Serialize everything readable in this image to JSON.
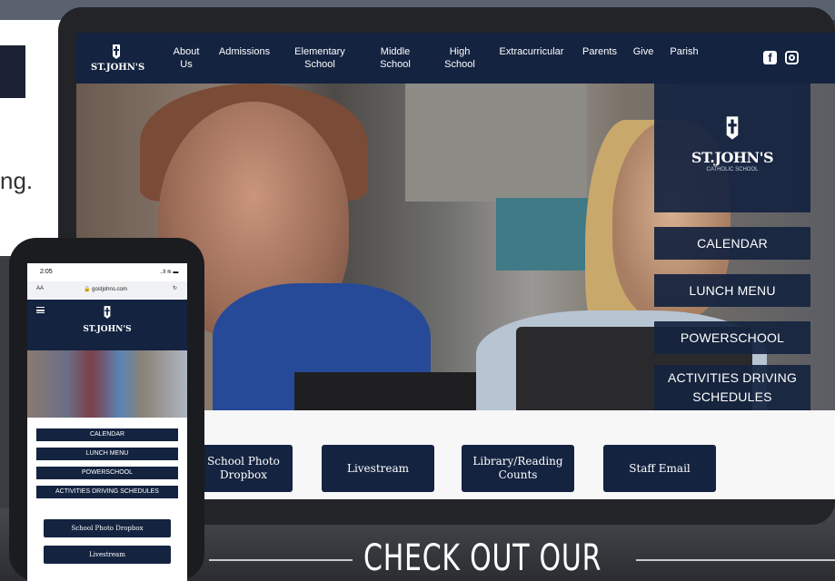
{
  "colors": {
    "navy": "#142340",
    "white": "#ffffff",
    "device_dark": "#222428",
    "background": "#3a3d42"
  },
  "background": {
    "side_text": "ng.",
    "tagline": "CHECK OUT OUR"
  },
  "tablet": {
    "nav": {
      "logo_text": "ST.JOHN'S",
      "items": [
        {
          "label": "About Us"
        },
        {
          "label": "Admissions"
        },
        {
          "label": "Elementary School"
        },
        {
          "label": "Middle School"
        },
        {
          "label": "High School"
        },
        {
          "label": "Extracurricular"
        },
        {
          "label": "Parents"
        },
        {
          "label": "Give"
        },
        {
          "label": "Parish"
        }
      ],
      "social_icons": [
        "facebook-icon",
        "instagram-icon"
      ]
    },
    "side_panel": {
      "logo_text": "ST.JOHN'S",
      "logo_subtext": "CATHOLIC SCHOOL",
      "buttons": [
        {
          "label": "CALENDAR"
        },
        {
          "label": "LUNCH MENU"
        },
        {
          "label": "POWERSCHOOL"
        },
        {
          "label": "ACTIVITIES DRIVING SCHEDULES"
        }
      ]
    },
    "quick_links": [
      {
        "label": "School Photo Dropbox"
      },
      {
        "label": "Livestream"
      },
      {
        "label": "Library/Reading Counts"
      },
      {
        "label": "Staff Email"
      }
    ]
  },
  "phone": {
    "status": {
      "time": "2:05",
      "signal": "..ll ≋ ▬"
    },
    "url_bar": {
      "aa": "AA",
      "host": "🔒 gostjohns.com",
      "reload": "↻"
    },
    "logo_text": "ST.JOHN'S",
    "buttons": [
      {
        "label": "CALENDAR"
      },
      {
        "label": "LUNCH MENU"
      },
      {
        "label": "POWERSCHOOL"
      },
      {
        "label": "ACTIVITIES DRIVING SCHEDULES"
      }
    ],
    "quick_links": [
      {
        "label": "School Photo Dropbox"
      },
      {
        "label": "Livestream"
      }
    ]
  }
}
